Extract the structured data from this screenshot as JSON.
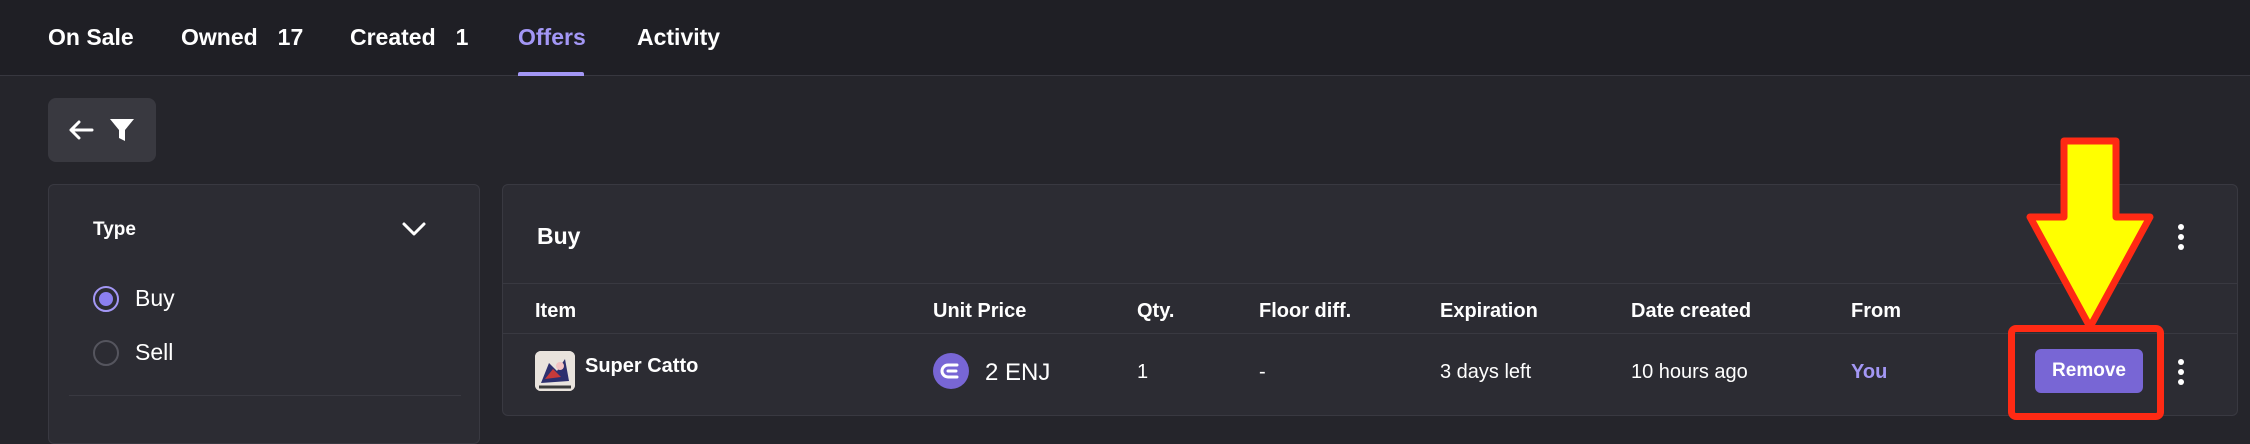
{
  "tabs": [
    {
      "label": "On Sale",
      "count": ""
    },
    {
      "label": "Owned",
      "count": "17"
    },
    {
      "label": "Created",
      "count": "1"
    },
    {
      "label": "Offers",
      "count": "",
      "active": true
    },
    {
      "label": "Activity",
      "count": ""
    }
  ],
  "toolbar": {
    "back_icon": "arrow-left-icon",
    "filter_icon": "filter-icon"
  },
  "sidebar": {
    "title": "Type",
    "chevron_icon": "chevron-down-icon",
    "options": [
      {
        "label": "Buy",
        "selected": true
      },
      {
        "label": "Sell",
        "selected": false
      }
    ]
  },
  "offers": {
    "title": "Buy",
    "columns": [
      "Item",
      "Unit Price",
      "Qty.",
      "Floor diff.",
      "Expiration",
      "Date created",
      "From"
    ],
    "rows": [
      {
        "item": "Super Catto",
        "unit_price": "2 ENJ",
        "price_icon": "enjin-coin-icon",
        "qty": "1",
        "floor_diff": "-",
        "expiration": "3 days left",
        "date_created": "10 hours ago",
        "from": "You",
        "action": "Remove"
      }
    ]
  },
  "colors": {
    "accent": "#a397f5",
    "button": "#7866d5",
    "annotation": "#ff2a14",
    "annotation_arrow": "#ffff00"
  }
}
